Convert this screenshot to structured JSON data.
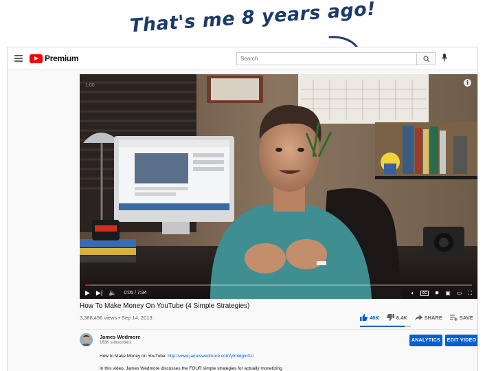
{
  "annotation": {
    "text": "That's me 8 years ago!"
  },
  "masthead": {
    "logo_text": "Premium",
    "search_placeholder": "Search"
  },
  "player": {
    "overlay_time": "1:00",
    "current_time": "0:05",
    "duration": "7:34",
    "time_display": "0:05 / 7:34",
    "progress_fraction": 0.011,
    "cc_label": "CC",
    "info_label": "i",
    "logo_mug_text": "You Tube"
  },
  "video": {
    "title": "How To Make Money On YouTube (4 Simple Strategies)",
    "meta": "3,388,496 views • Sep 14, 2013",
    "likes": "46K",
    "dislikes": "6.4K",
    "share_label": "SHARE",
    "save_label": "SAVE",
    "more_label": "···",
    "like_ratio": 0.88
  },
  "channel": {
    "name": "James Wedmore",
    "subscribers": "163K subscribers",
    "analytics_label": "ANALYTICS",
    "edit_label": "EDIT VIDEO"
  },
  "description": {
    "line1_prefix": "How to Make Money on YouTube: ",
    "line1_link": "http://www.jameswedmore.com/ytmktgm01/",
    "line2": "In this video, James Wedmore discusses the FOUR simple strategies for actually monetizing"
  },
  "colors": {
    "brand_red": "#ff0000",
    "accent_blue": "#065fd4",
    "annotation_ink": "#1c3a6b"
  }
}
